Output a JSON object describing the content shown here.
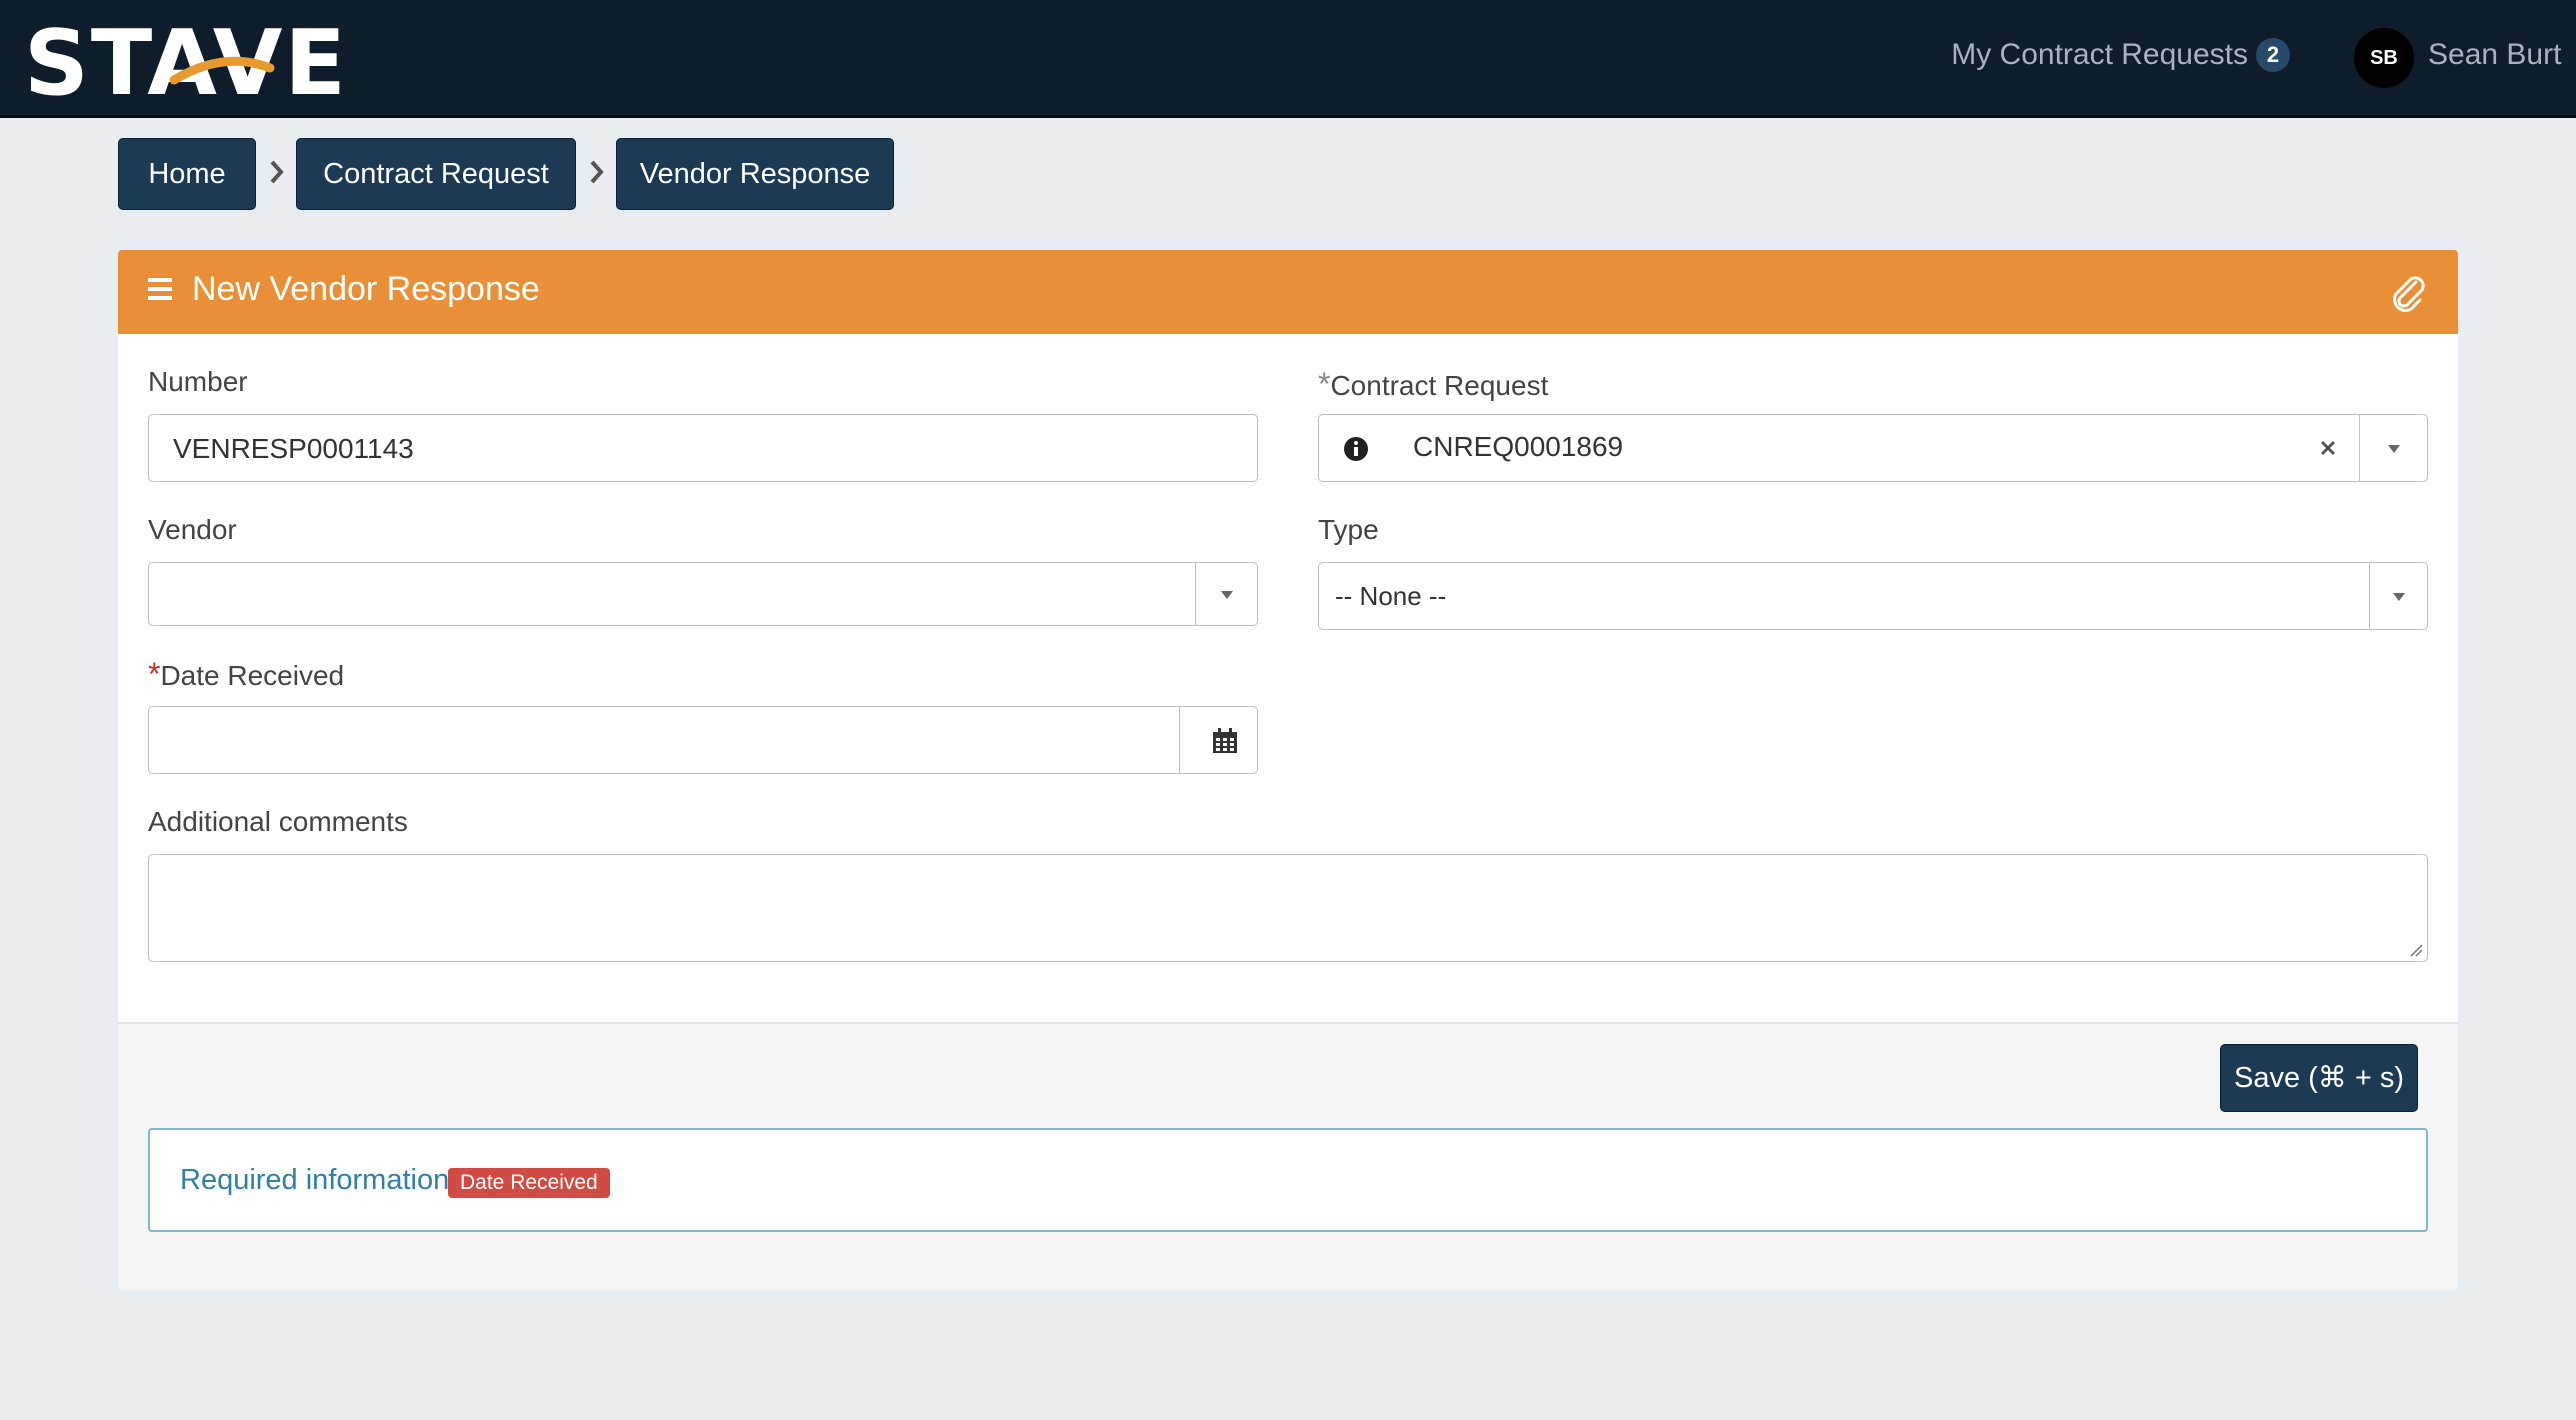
{
  "app": {
    "logo_text": "STAVE",
    "nav_requests_label": "My Contract Requests",
    "nav_requests_count": "2",
    "user_initials": "SB",
    "user_name": "Sean Burt"
  },
  "breadcrumb": [
    "Home",
    "Contract Request",
    "Vendor Response"
  ],
  "form": {
    "title": "New Vendor Response",
    "fields": {
      "number": {
        "label": "Number",
        "value": "VENRESP0001143"
      },
      "contract_request": {
        "label": "Contract Request",
        "value": "CNREQ0001869",
        "required": true
      },
      "vendor": {
        "label": "Vendor",
        "value": ""
      },
      "type": {
        "label": "Type",
        "value": "-- None --"
      },
      "date_received": {
        "label": "Date Received",
        "value": "",
        "required": true
      },
      "additional_comments": {
        "label": "Additional comments",
        "value": ""
      }
    },
    "save_label": "Save (⌘ + s)",
    "required_info": {
      "label": "Required information",
      "missing": "Date Received"
    }
  },
  "colors": {
    "topbar": "#0f1c29",
    "accent_orange": "#e88f37",
    "button_navy": "#1d3a55",
    "required_red": "#cf4b43",
    "info_blue": "#2f7fa8"
  },
  "icons": [
    "menu-icon",
    "paperclip-icon",
    "info-circle-icon",
    "clear-x-icon",
    "chevron-right-icon",
    "caret-down-icon",
    "calendar-icon"
  ]
}
